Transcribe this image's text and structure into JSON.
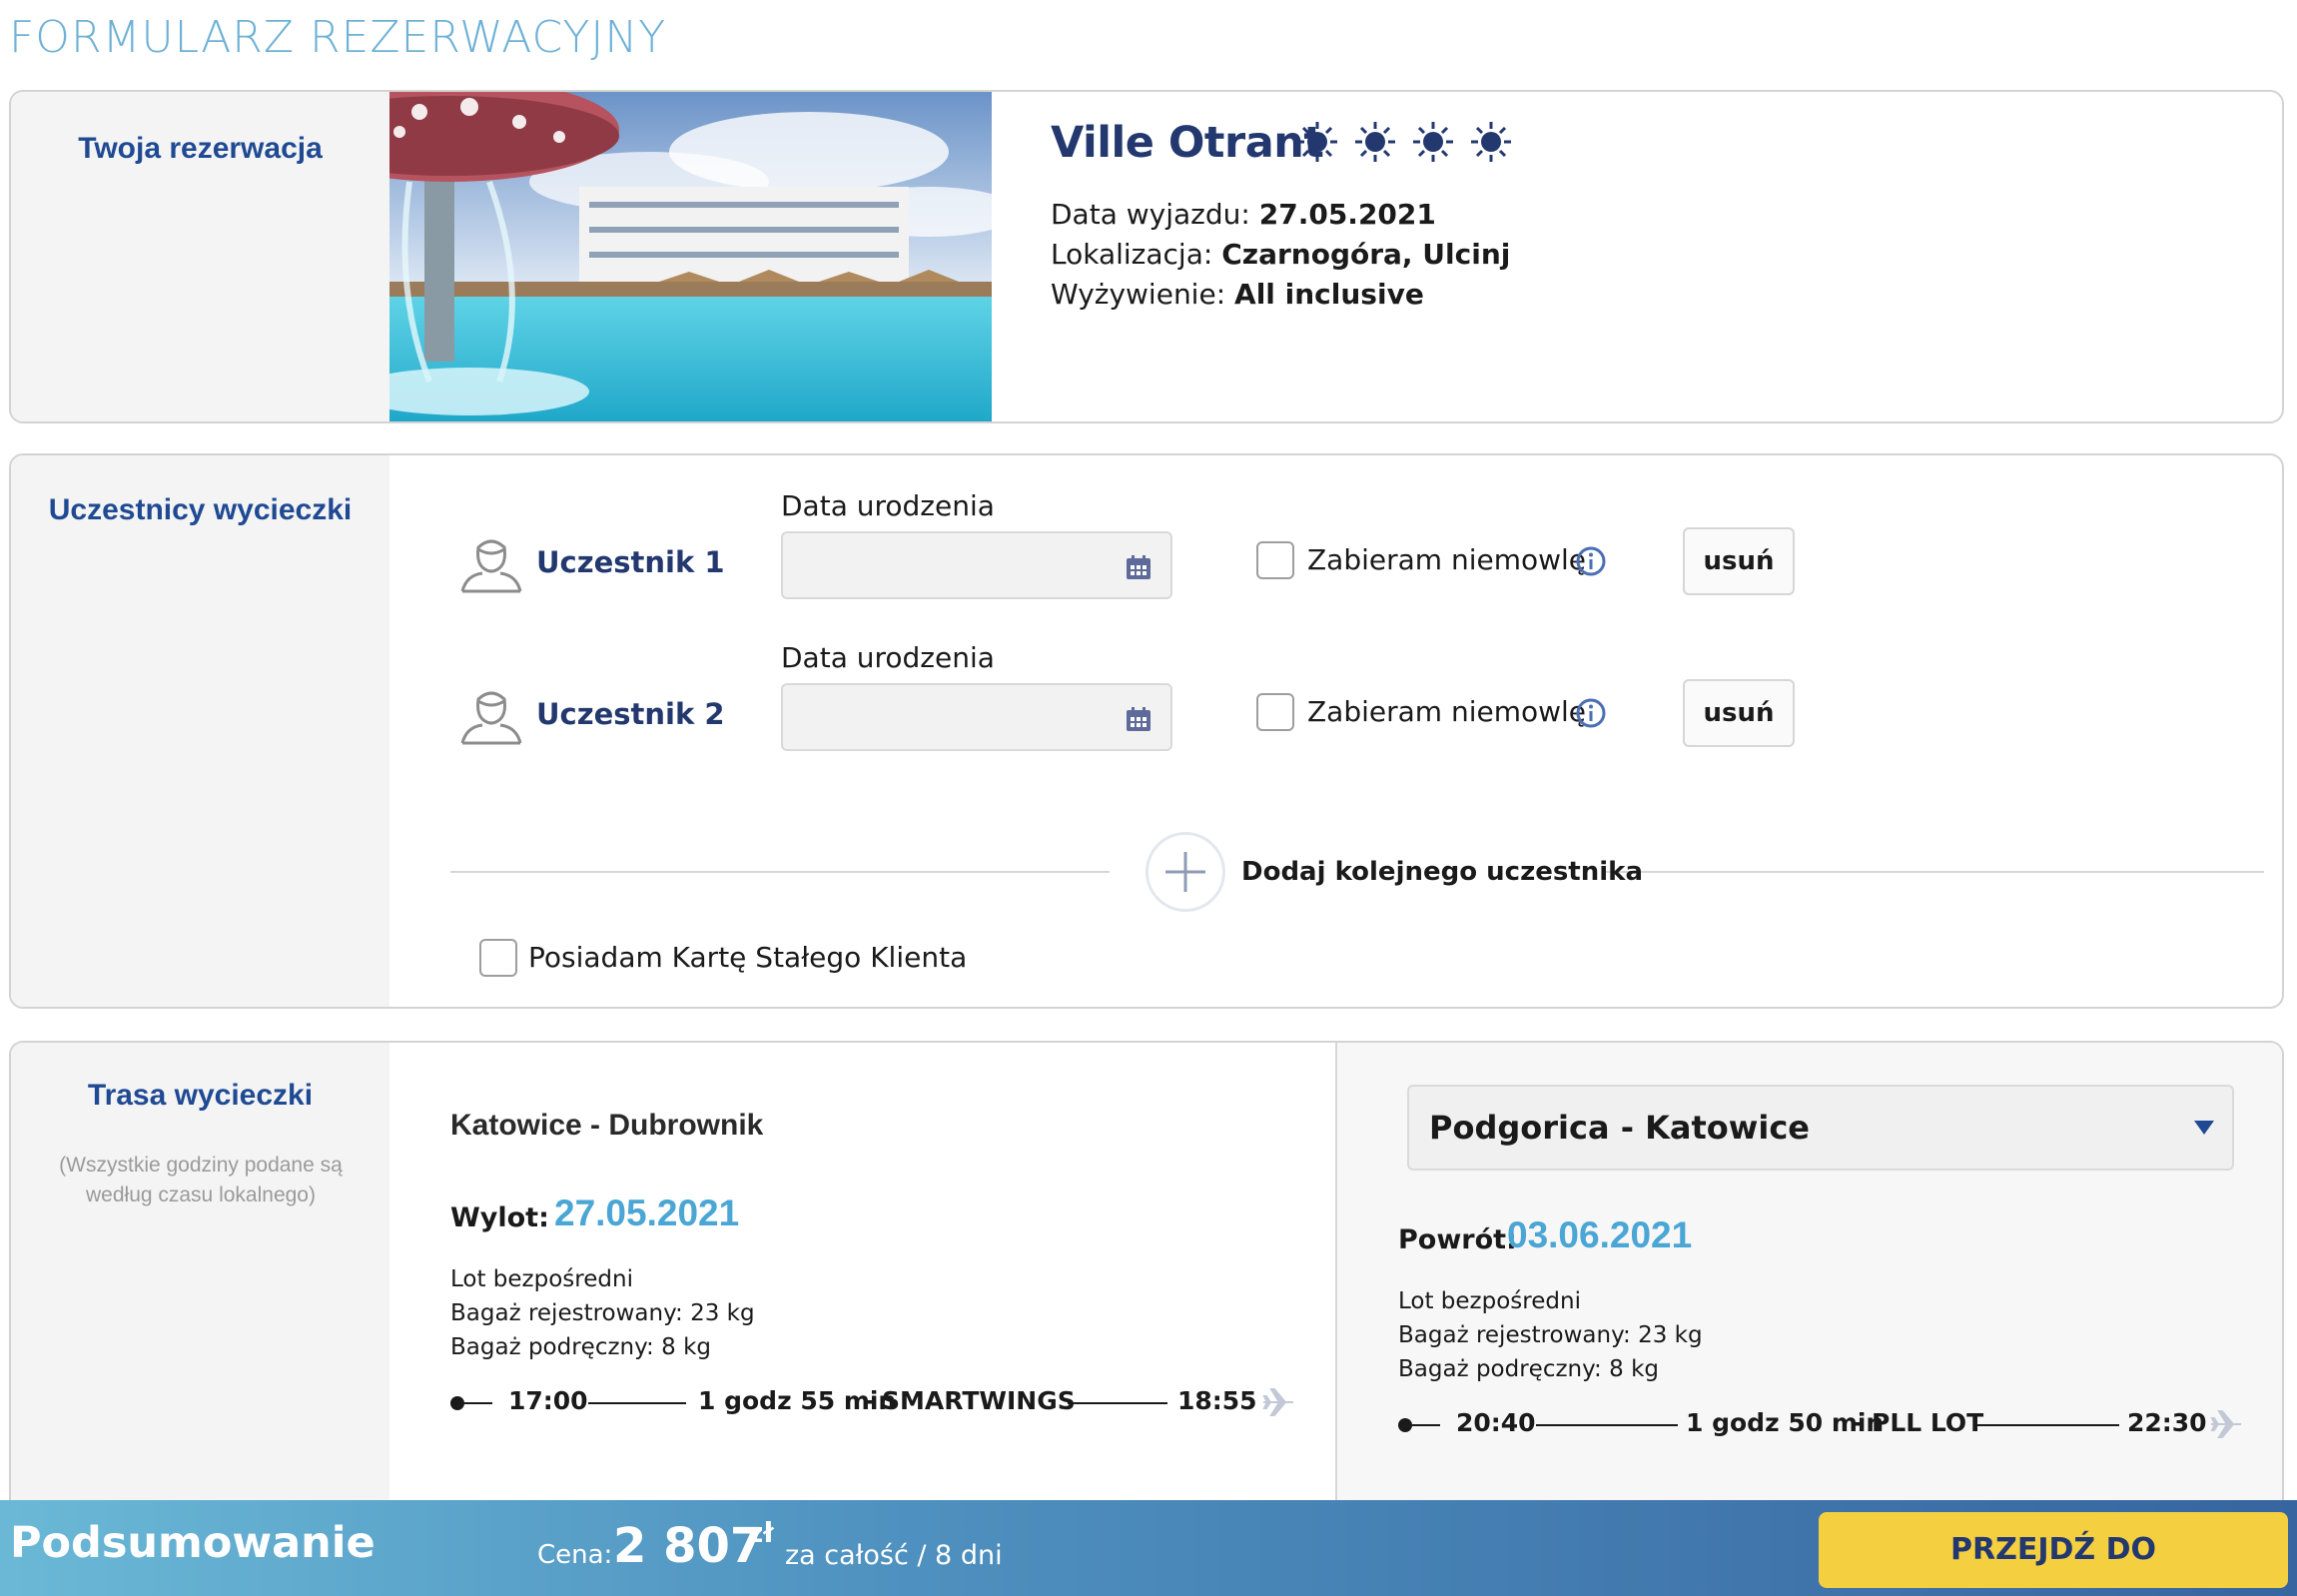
{
  "page": {
    "title": "FORMULARZ REZERWACYJNY"
  },
  "reservation": {
    "section_label": "Twoja rezerwacja",
    "hotel_name": "Ville Otrant",
    "star_count": 4,
    "departure_label": "Data wyjazdu:",
    "departure_value": "27.05.2021",
    "location_label": "Lokalizacja:",
    "location_value": "Czarnogóra, Ulcinj",
    "board_label": "Wyżywienie:",
    "board_value": "All inclusive"
  },
  "participants": {
    "section_label": "Uczestnicy wycieczki",
    "items": [
      {
        "name": "Uczestnik 1",
        "birth_label": "Data urodzenia",
        "birth_value": "",
        "infant_label": "Zabieram niemowlę",
        "infant_checked": false,
        "remove_label": "usuń"
      },
      {
        "name": "Uczestnik 2",
        "birth_label": "Data urodzenia",
        "birth_value": "",
        "infant_label": "Zabieram niemowlę",
        "infant_checked": false,
        "remove_label": "usuń"
      }
    ],
    "add_label": "Dodaj kolejnego uczestnika",
    "loyalty_label": "Posiadam Kartę Stałego Klienta",
    "loyalty_checked": false
  },
  "route": {
    "section_label": "Trasa wycieczki",
    "note": "(Wszystkie godziny podane są według czasu lokalnego)",
    "outbound": {
      "title": "Katowice - Dubrownik",
      "label": "Wylot:",
      "date": "27.05.2021",
      "type": "Lot bezpośredni",
      "checked_bag": "Bagaż rejestrowany: 23 kg",
      "hand_bag": "Bagaż podręczny: 8 kg",
      "dep_time": "17:00",
      "duration": "1 godz 55 min",
      "separator": "-",
      "carrier": "SMARTWINGS",
      "arr_time": "18:55"
    },
    "return": {
      "title": "Podgorica - Katowice",
      "label": "Powrót:",
      "date": "03.06.2021",
      "type": "Lot bezpośredni",
      "checked_bag": "Bagaż rejestrowany: 23 kg",
      "hand_bag": "Bagaż podręczny: 8 kg",
      "dep_time": "20:40",
      "duration": "1 godz 50 min",
      "separator": "-",
      "carrier": "PLL LOT",
      "arr_time": "22:30"
    }
  },
  "summary": {
    "title": "Podsumowanie",
    "price_label": "Cena:",
    "price_value": "2 807",
    "currency": "zł",
    "price_suffix": "za całość / 8 dni",
    "cta_label": "PRZEJDŹ DO PODSUMOWANIA"
  },
  "colors": {
    "brand_dark": "#23386f",
    "brand_blue": "#1f4a93",
    "accent_light": "#4aa6d4",
    "cta": "#f4cf3f"
  },
  "icons": {
    "star": "sun-star-icon",
    "participant": "person-outline-icon",
    "calendar": "calendar-icon",
    "info": "info-icon",
    "add": "plus-icon",
    "plane": "plane-icon",
    "dropdown": "chevron-down-icon"
  }
}
